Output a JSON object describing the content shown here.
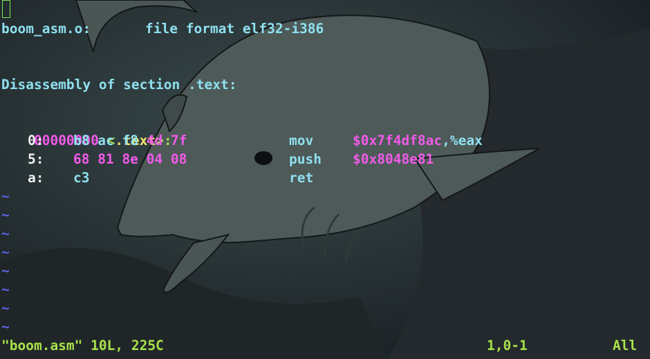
{
  "colors": {
    "cyan": "#8fe0ef",
    "green": "#a8e24a",
    "magenta": "#f25ae8",
    "yellow": "#f2e36b",
    "white": "#f0f0f0",
    "tilde": "#5b63e8"
  },
  "header": {
    "filename": "boom_asm.o:",
    "format_label": "file format elf32-i386"
  },
  "section": {
    "title": "Disassembly of section .text:"
  },
  "symbol": {
    "address": "00000000",
    "open": " <",
    "name": ".text",
    "close": ">:"
  },
  "instructions": [
    {
      "offset": "0:",
      "bytes_plain": "b8 ac f8 ",
      "bytes_hl": "4d 7f",
      "mnemonic": "mov",
      "operand_hl": "$0x7f4df8ac",
      "operand_plain": ",%eax"
    },
    {
      "offset": "5:",
      "bytes_plain": "",
      "bytes_hl": "68 81 8e 04 08",
      "mnemonic": "push",
      "operand_hl": "$0x8048e81",
      "operand_plain": ""
    },
    {
      "offset": "a:",
      "bytes_plain": "c3",
      "bytes_hl": "",
      "mnemonic": "ret",
      "operand_hl": "",
      "operand_plain": ""
    }
  ],
  "empty_line_marker": "~",
  "statusbar": {
    "file_info": "\"boom.asm\" 10L, 225C",
    "position": "1,0-1",
    "scroll": "All"
  }
}
